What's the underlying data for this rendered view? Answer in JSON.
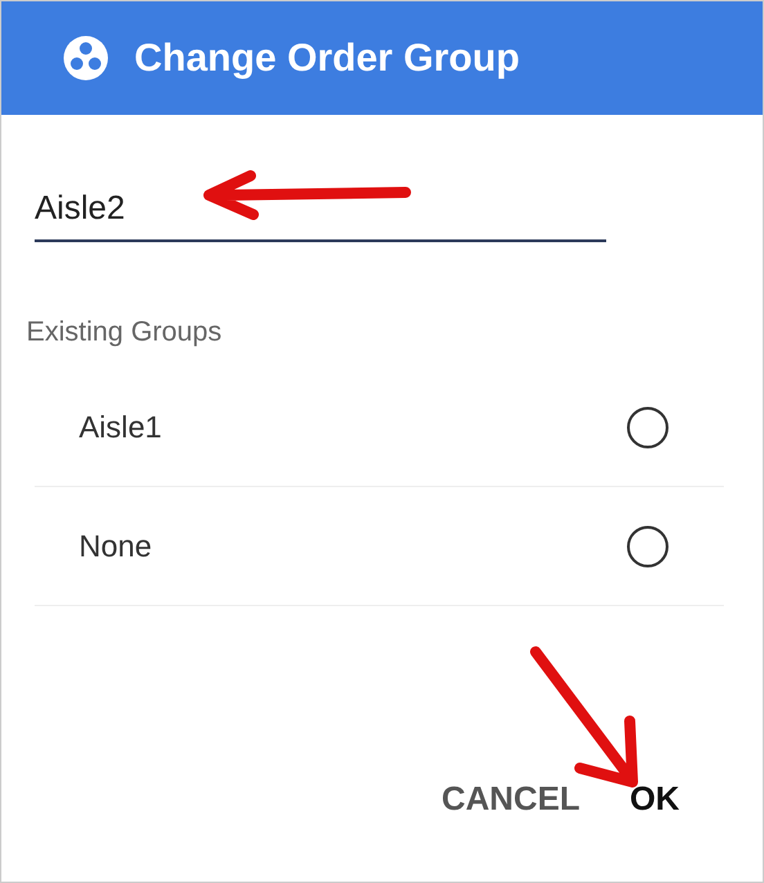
{
  "dialog": {
    "title": "Change Order Group"
  },
  "name_field": {
    "value": "Aisle2"
  },
  "section_label": "Existing Groups",
  "groups": [
    {
      "label": "Aisle1",
      "selected": false
    },
    {
      "label": "None",
      "selected": false
    }
  ],
  "buttons": [
    {
      "label": "CANCEL",
      "kind": "secondary"
    },
    {
      "label": "OK",
      "kind": "primary"
    }
  ]
}
